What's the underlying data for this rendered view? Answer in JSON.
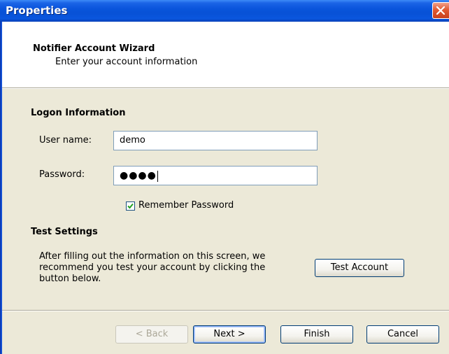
{
  "window": {
    "title": "Properties"
  },
  "header": {
    "title": "Notifier Account Wizard",
    "subtitle": "Enter your account information"
  },
  "logon": {
    "section_title": "Logon Information",
    "username_label": "User name:",
    "username_value": "demo",
    "password_label": "Password:",
    "password_mask": "●●●●",
    "remember_label": "Remember Password",
    "remember_checked": true
  },
  "test": {
    "section_title": "Test Settings",
    "help_text": "After filling out the information on this screen, we\nrecommend you test your account by clicking the\nbutton below.",
    "test_button": "Test Account"
  },
  "footer": {
    "back": "< Back",
    "next": "Next >",
    "finish": "Finish",
    "cancel": "Cancel"
  },
  "icons": {
    "close": "close-icon",
    "check": "checkmark-icon"
  },
  "colors": {
    "titlebar": "#0a55dc",
    "dialog_bg": "#ece9d8",
    "close_button": "#e15a33",
    "check": "#21a121"
  }
}
